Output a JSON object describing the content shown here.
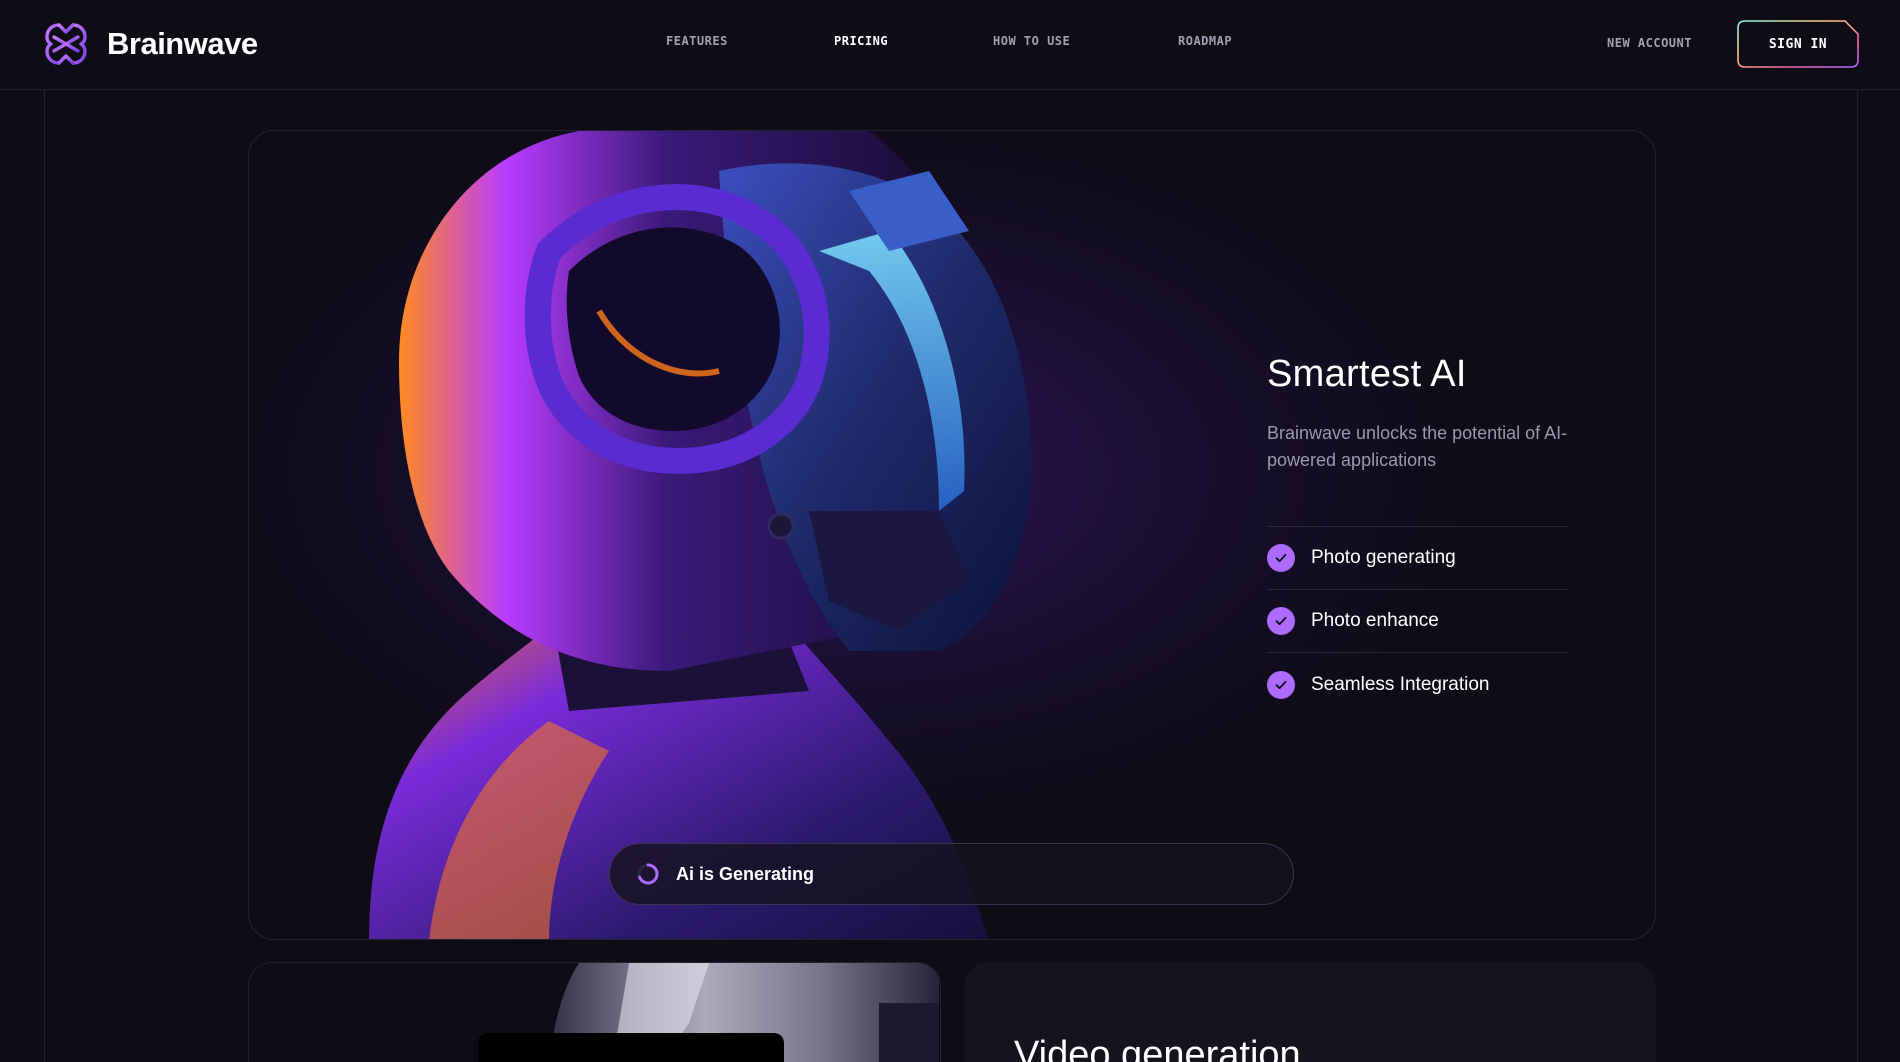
{
  "brand": {
    "name": "Brainwave",
    "logo_icon": "brain-logo-icon"
  },
  "nav": {
    "items": [
      {
        "label": "FEATURES",
        "active": false
      },
      {
        "label": "PRICING",
        "active": true
      },
      {
        "label": "HOW TO USE",
        "active": false
      },
      {
        "label": "ROADMAP",
        "active": false
      }
    ],
    "new_account": "NEW ACCOUNT",
    "sign_in": "SIGN IN"
  },
  "hero": {
    "title": "Smartest AI",
    "subtitle": "Brainwave unlocks the potential of AI-powered applications",
    "features": [
      {
        "label": "Photo generating",
        "icon": "check-icon"
      },
      {
        "label": "Photo enhance",
        "icon": "check-icon"
      },
      {
        "label": "Seamless Integration",
        "icon": "check-icon"
      }
    ],
    "status": {
      "label": "Ai is Generating",
      "icon": "loading-spinner-icon"
    }
  },
  "cards": {
    "video_title": "Video generation"
  },
  "colors": {
    "background": "#0e0c15",
    "accent_purple": "#ac6aff",
    "text_muted": "#a5a1b5",
    "border": "#252134"
  }
}
